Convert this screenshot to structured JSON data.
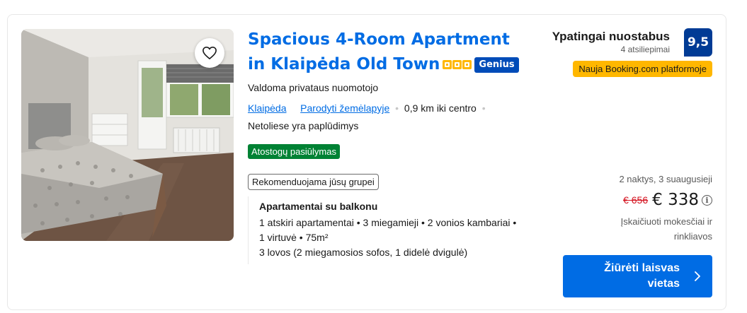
{
  "property": {
    "title": "Spacious 4-Room Apartment in Klaipėda Old Town",
    "star_count": 3,
    "genius_label": "Genius",
    "host_type": "Valdoma privataus nuomotojo",
    "city_link": "Klaipėda",
    "map_link": "Parodyti žemėlapyje",
    "distance": "0,9 km iki centro",
    "beach_note": "Netoliese yra paplūdimys",
    "deal_badge": "Atostogų pasiūlymas",
    "recommended_tag": "Rekomenduojama jūsų grupei"
  },
  "unit": {
    "name": "Apartamentai su balkonu",
    "details_line1": "1 atskiri apartamentai • 3 miegamieji • 2 vonios kambariai •",
    "details_line2": "1 virtuvė • 75m²",
    "beds": "3 lovos (2 miegamosios sofos, 1 didelė dvigulė)"
  },
  "review": {
    "label": "Ypatingai nuostabus",
    "count_text": "4 atsiliepimai",
    "score": "9,5",
    "new_badge": "Nauja Booking.com platformoje"
  },
  "pricing": {
    "stay_summary": "2 naktys, 3 suaugusieji",
    "old_price": "€ 656",
    "price": "€ 338",
    "taxes_note": "Įskaičiuoti mokesčiai ir rinkliavos",
    "cta_label": "Žiūrėti laisvas vietas"
  },
  "colors": {
    "link_blue": "#006ce4",
    "score_navy": "#003b95",
    "genius_blue": "#004cb8",
    "deal_green": "#008234",
    "star_yellow": "#ffb700",
    "strike_red": "#d4111e"
  }
}
